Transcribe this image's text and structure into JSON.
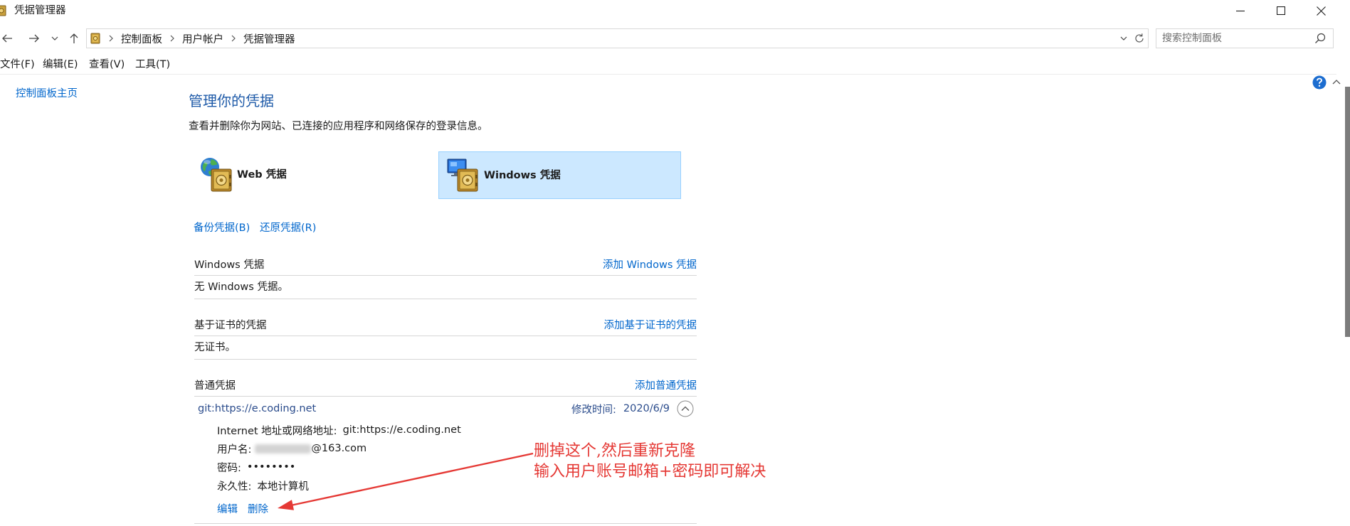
{
  "window": {
    "title": "凭据管理器",
    "app_icon": "credential-manager-icon",
    "controls": [
      "minimize-icon",
      "maximize-icon",
      "close-icon"
    ]
  },
  "navigation": {
    "back_icon": "back-arrow-icon",
    "forward_icon": "forward-arrow-icon",
    "recent_icon": "chevron-down-icon",
    "up_icon": "up-arrow-icon"
  },
  "address_bar": {
    "root_icon": "control-panel-icon",
    "breadcrumbs": [
      "控制面板",
      "用户帐户",
      "凭据管理器"
    ],
    "separator_icon": "chevron-right-icon",
    "dropdown_icon": "chevron-down-icon",
    "refresh_icon": "refresh-icon"
  },
  "search": {
    "placeholder": "搜索控制面板",
    "icon": "search-icon"
  },
  "menu": {
    "items": [
      "文件(F)",
      "编辑(E)",
      "查看(V)",
      "工具(T)"
    ]
  },
  "sidebar": {
    "home_link": "控制面板主页"
  },
  "help": {
    "icon": "help-icon"
  },
  "main": {
    "title": "管理你的凭据",
    "description": "查看并删除你为网站、已连接的应用程序和网络保存的登录信息。",
    "tiles": [
      {
        "label": "Web 凭据",
        "icon": "web-credentials-icon",
        "selected": false
      },
      {
        "label": "Windows 凭据",
        "icon": "windows-credentials-icon",
        "selected": true
      }
    ],
    "backup_link": "备份凭据(B)",
    "restore_link": "还原凭据(R)",
    "sections": [
      {
        "title": "Windows 凭据",
        "add_link": "添加 Windows 凭据",
        "empty_text": "无 Windows 凭据。"
      },
      {
        "title": "基于证书的凭据",
        "add_link": "添加基于证书的凭据",
        "empty_text": "无证书。"
      },
      {
        "title": "普通凭据",
        "add_link": "添加普通凭据",
        "entries": [
          {
            "name": "git:https://e.coding.net",
            "modified_label": "修改时间:",
            "modified_date": "2020/6/9",
            "expanded": true,
            "collapse_icon": "chevron-up-circle-icon",
            "details": {
              "address_label": "Internet 地址或网络地址:",
              "address_value": "git:https://e.coding.net",
              "username_label": "用户名:",
              "username_value": "@163.com",
              "username_blurred": true,
              "password_label": "密码:",
              "password_value": "••••••••",
              "persistence_label": "永久性:",
              "persistence_value": "本地计算机"
            },
            "edit_link": "编辑",
            "delete_link": "删除"
          }
        ]
      }
    ]
  },
  "annotation": {
    "lines": [
      "删掉这个,然后重新克隆",
      "输入用户账号邮箱+密码即可解决"
    ]
  },
  "colors": {
    "link": "#0066cc",
    "heading": "#1e5aa8",
    "entry": "#2b4c8c",
    "selected_tile_bg": "#cce8ff",
    "selected_tile_border": "#99d1ff",
    "annotation": "#e53935",
    "help": "#1c6dd0"
  }
}
